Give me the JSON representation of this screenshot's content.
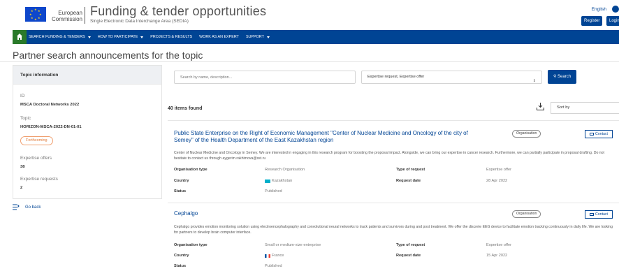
{
  "header": {
    "ec_line1": "European",
    "ec_line2": "Commission",
    "site_title": "Funding & tender opportunities",
    "site_subtitle": "Single Electronic Data Interchange Area (SEDIA)",
    "language": "English",
    "register_label": "Register",
    "login_label": "Login"
  },
  "nav": {
    "items": [
      {
        "label": "SEARCH FUNDING & TENDERS"
      },
      {
        "label": "HOW TO PARTICIPATE"
      },
      {
        "label": "PROJECTS & RESULTS"
      },
      {
        "label": "WORK AS AN EXPERT"
      },
      {
        "label": "SUPPORT"
      }
    ]
  },
  "page_title": "Partner search announcements for the topic",
  "sidebar": {
    "heading": "Topic information",
    "id_label": "ID",
    "id_value": "MSCA Doctoral Networks 2022",
    "topic_label": "Topic",
    "topic_value": "HORIZON-MSCA-2022-DN-01-01",
    "status_badge": "Forthcoming",
    "offers_label": "Expertise offers",
    "offers_value": "38",
    "requests_label": "Expertise requests",
    "requests_value": "2",
    "go_back": "Go back"
  },
  "search": {
    "placeholder": "Search by name, description...",
    "filter_value": "Expertise request, Expertise offer",
    "button_label": "Search"
  },
  "results": {
    "count_text": "40 items found",
    "sort_label": "Sort by"
  },
  "cards": [
    {
      "title": "Public State Enterprise on the Right of Economic Management \"Center of Nuclear Medicine and Oncology of the city of Semey\" of the Health Department of the East Kazakhstan region",
      "tag": "Organisation",
      "contact": "Contact",
      "description": "Center of Nuclear Medicine and Oncology in Semey. We are interested in engaging in this research program for boosting the proposal impact. Alongside, we can bring our expertise in cancer research. Furthermore, we can partially participate in proposal drafting. Do not hesitate to contact us through aygerim.rakhimova@sst.ru",
      "org_type_label": "Organisation type",
      "org_type": "Research Organisation",
      "country_label": "Country",
      "country": "Kazakhstan",
      "status_label": "Status",
      "status": "Published",
      "req_type_label": "Type of request",
      "req_type": "Expertise offer",
      "req_date_label": "Request date",
      "req_date": "28 Apr 2022"
    },
    {
      "title": "Cephalgo",
      "tag": "Organisation",
      "contact": "Contact",
      "description": "Cephalgo provides emotion monitoring solution using electroencephalography and convolutional neural networks to track patients and survivors during and post treatment. We offer the discrete EEG device to facilitate emotion tracking continuously in daily life. We are looking for partners to develop brain computer interface.",
      "org_type_label": "Organisation type",
      "org_type": "Small or medium-size enterprise",
      "country_label": "Country",
      "country": "France",
      "status_label": "Status",
      "status": "Published",
      "req_type_label": "Type of request",
      "req_type": "Expertise offer",
      "req_date_label": "Request date",
      "req_date": "15 Apr 2022"
    }
  ],
  "colors": {
    "primary": "#004494",
    "home_green": "#2a7a2a",
    "badge_orange": "#e07b39"
  }
}
